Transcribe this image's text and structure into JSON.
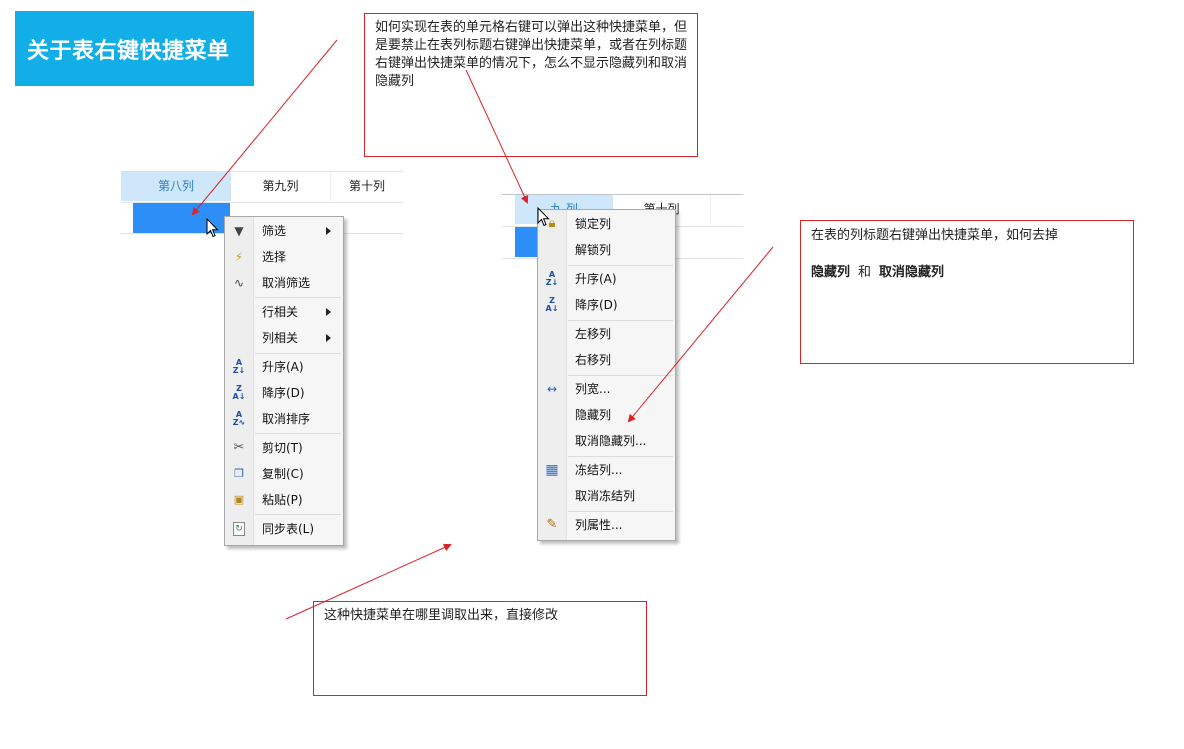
{
  "banner": {
    "title": "关于表右键快捷菜单"
  },
  "notes": {
    "top": "如何实现在表的单元格右键可以弹出这种快捷菜单，但是要禁止在表列标题右键弹出快捷菜单，或者在列标题右键弹出快捷菜单的情况下，怎么不显示隐藏列和取消隐藏列",
    "right_line1": "在表的列标题右键弹出快捷菜单，如何去掉",
    "right_term1": "隐藏列",
    "right_and": "和",
    "right_term2": "取消隐藏列",
    "bottom": "这种快捷菜单在哪里调取出来，直接修改"
  },
  "grid_left": {
    "col8": "第八列",
    "col9": "第九列",
    "col10": "第十列"
  },
  "grid_right": {
    "col_partial": "九 列",
    "col10": "第十列"
  },
  "cell_menu": {
    "items": [
      {
        "label": "筛选",
        "icon": "funnel-icon"
      },
      {
        "label": "选择",
        "icon": "filter-select-icon"
      },
      {
        "label": "取消筛选",
        "icon": "filter-clear-icon"
      },
      {
        "label": "行相关"
      },
      {
        "label": "列相关"
      },
      {
        "label": "升序(A)",
        "icon": "sort-ascending-icon"
      },
      {
        "label": "降序(D)",
        "icon": "sort-descending-icon"
      },
      {
        "label": "取消排序",
        "icon": "sort-clear-icon"
      },
      {
        "label": "剪切(T)",
        "icon": "scissors-icon"
      },
      {
        "label": "复制(C)",
        "icon": "copy-icon"
      },
      {
        "label": "粘贴(P)",
        "icon": "paste-icon"
      },
      {
        "label": "同步表(L)",
        "icon": "sync-table-icon"
      }
    ]
  },
  "header_menu": {
    "items": [
      {
        "label": "锁定列",
        "icon": "lock-icon"
      },
      {
        "label": "解锁列"
      },
      {
        "label": "升序(A)",
        "icon": "sort-ascending-icon"
      },
      {
        "label": "降序(D)",
        "icon": "sort-descending-icon"
      },
      {
        "label": "左移列"
      },
      {
        "label": "右移列"
      },
      {
        "label": "列宽...",
        "icon": "column-width-icon"
      },
      {
        "label": "隐藏列"
      },
      {
        "label": "取消隐藏列..."
      },
      {
        "label": "冻结列...",
        "icon": "grid-icon"
      },
      {
        "label": "取消冻结列"
      },
      {
        "label": "列属性...",
        "icon": "properties-icon"
      }
    ]
  },
  "colors": {
    "accent": "#11aee8",
    "annotation": "#d8252b",
    "selection": "#2d8ef7"
  }
}
